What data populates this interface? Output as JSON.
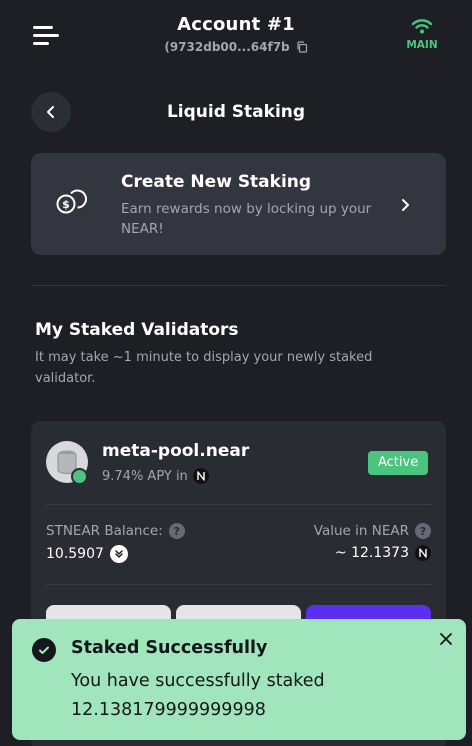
{
  "header": {
    "account_title": "Account #1",
    "account_address": "(9732db00...64f7b",
    "network_label": "MAIN",
    "network_color": "#4bc47f"
  },
  "page": {
    "title": "Liquid Staking"
  },
  "create_staking": {
    "title": "Create New Staking",
    "description": "Earn rewards now by locking up your NEAR!"
  },
  "my_validators": {
    "title": "My Staked Validators",
    "description": "It may take ~1 minute to display your newly staked validator."
  },
  "validator": {
    "name": "meta-pool.near",
    "apy_text": "9.74% APY in",
    "status": "Active",
    "status_color": "#4bc47f",
    "balance_label": "STNEAR Balance:",
    "balance_value": "10.5907",
    "value_label": "Value in NEAR",
    "value_amount": "~ 12.1373",
    "buttons": [
      {
        "color": "#e4e5e9"
      },
      {
        "color": "#e4e5e9"
      },
      {
        "color": "#5b2ef0"
      }
    ]
  },
  "toast": {
    "title": "Staked Successfully",
    "message": "You have successfully staked 12.138179999999998",
    "background": "#a0e5bc"
  }
}
